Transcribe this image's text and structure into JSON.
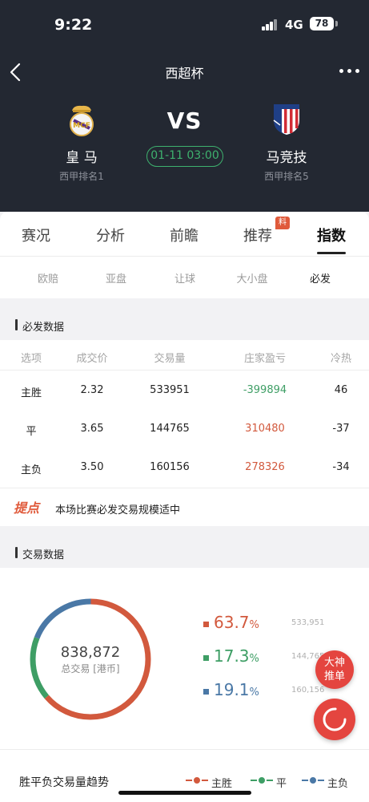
{
  "status_bar": {
    "time": "9:22",
    "network": "4G",
    "battery": "78"
  },
  "header": {
    "title": "西超杯"
  },
  "match": {
    "vs": "VS",
    "kickoff": "01-11 03:00",
    "home": {
      "name": "皇 马",
      "rank": "西甲排名1"
    },
    "away": {
      "name": "马竞技",
      "rank": "西甲排名5"
    }
  },
  "tabs": [
    {
      "label": "赛况"
    },
    {
      "label": "分析"
    },
    {
      "label": "前瞻"
    },
    {
      "label": "推荐",
      "badge": "料"
    },
    {
      "label": "指数",
      "active": true
    }
  ],
  "subtabs": [
    {
      "label": "欧赔"
    },
    {
      "label": "亚盘"
    },
    {
      "label": "让球"
    },
    {
      "label": "大小盘"
    },
    {
      "label": "必发",
      "active": true
    }
  ],
  "bifa": {
    "title": "必发数据",
    "headers": [
      "选项",
      "成交价",
      "交易量",
      "庄家盈亏",
      "冷热"
    ],
    "rows": [
      {
        "option": "主胜",
        "price": "2.32",
        "volume": "533951",
        "pnl": "-399894",
        "heat": "46"
      },
      {
        "option": "平",
        "price": "3.65",
        "volume": "144765",
        "pnl": "310480",
        "heat": "-37"
      },
      {
        "option": "主负",
        "price": "3.50",
        "volume": "160156",
        "pnl": "278326",
        "heat": "-34"
      }
    ]
  },
  "tip": {
    "logo_text": "提点",
    "text": "本场比赛必发交易规模适中"
  },
  "trade": {
    "title": "交易数据",
    "total_value": "838,872",
    "total_label": "总交易 [港币]",
    "stats": [
      {
        "pct": "63.7",
        "unit": "%",
        "volume": "533,951",
        "color": "#d2593d"
      },
      {
        "pct": "17.3",
        "unit": "%",
        "volume": "144,765",
        "color": "#3e9e65"
      },
      {
        "pct": "19.1",
        "unit": "%",
        "volume": "160,156",
        "color": "#4a78a6"
      }
    ]
  },
  "fab": {
    "master_line1": "大神",
    "master_line2": "推单"
  },
  "trend": {
    "title": "胜平负交易量趋势",
    "legend": [
      {
        "label": "主胜",
        "color": "#d2593d"
      },
      {
        "label": "平",
        "color": "#3e9e65"
      },
      {
        "label": "主负",
        "color": "#4a78a6"
      }
    ]
  },
  "colors": {
    "dark_bg": "#232832",
    "accent_green": "#3eb16e",
    "accent_red": "#e4453f"
  }
}
